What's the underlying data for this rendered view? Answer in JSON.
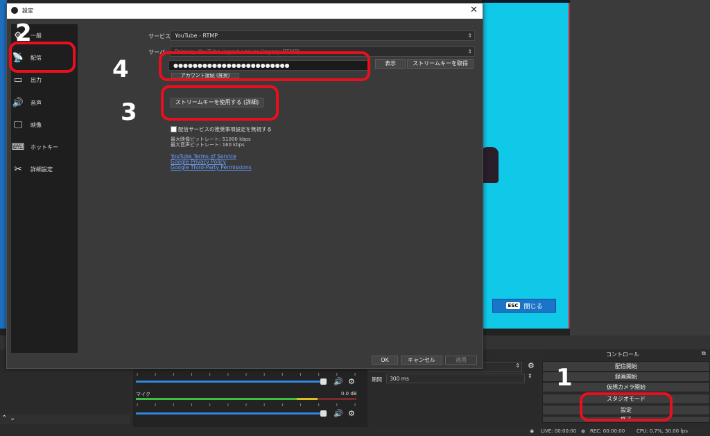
{
  "dialog": {
    "title": "設定",
    "sidebar": [
      {
        "label": "一般",
        "icon": "gear-icon"
      },
      {
        "label": "配信",
        "icon": "broadcast-tower-icon"
      },
      {
        "label": "出力",
        "icon": "output-icon"
      },
      {
        "label": "音声",
        "icon": "speaker-icon"
      },
      {
        "label": "映像",
        "icon": "monitor-icon"
      },
      {
        "label": "ホットキー",
        "icon": "keyboard-icon"
      },
      {
        "label": "詳細設定",
        "icon": "tools-icon"
      }
    ],
    "service_label": "サービス",
    "service_value": "YouTube - RTMP",
    "server_label": "サーバ",
    "server_value": "Primary YouTube ingest server (legacy RTMP)",
    "stream_key_value": "●●●●●●●●●●●●●●●●●●●●●●●●",
    "show_button": "表示",
    "get_key_button": "ストリームキーを取得",
    "connect_account_button": "アカウント接続 (推奨)",
    "use_stream_key_button": "ストリームキーを使用する (詳細)",
    "ignore_checkbox_label": "配信サービスの推奨事項設定を無視する",
    "max_video_bitrate": "最大映像ビットレート: 51000 kbps",
    "max_audio_bitrate": "最大音声ビットレート: 160 kbps",
    "links": [
      "YouTube Terms of Service",
      "Google Privacy Policy",
      "Google Third-Party Permissions"
    ],
    "ok_button": "OK",
    "cancel_button": "キャンセル",
    "apply_button": "適用"
  },
  "preview": {
    "close_button": "閉じる",
    "esc_label": "ESC"
  },
  "controls": {
    "title": "コントロール",
    "buttons": [
      "配信開始",
      "録画開始",
      "仮想カメラ開始",
      "スタジオモード",
      "設定",
      "終了"
    ]
  },
  "transitions": {
    "duration_label": "期間",
    "duration_value": "300 ms"
  },
  "mixer": {
    "channel_name": "マイク",
    "db_value": "0.0 dB",
    "scale": [
      "-60",
      "-55",
      "-50",
      "-45",
      "-40",
      "-35",
      "-30",
      "-25",
      "-20",
      "-15",
      "-10",
      "-5",
      "0"
    ]
  },
  "status_bar": {
    "live": "LIVE: 00:00:00",
    "rec": "REC: 00:00:00",
    "cpu": "CPU: 0.7%, 30.00 fps"
  },
  "annotations": {
    "n1": "1",
    "n2": "2",
    "n3": "3",
    "n4": "4"
  },
  "colors": {
    "annotation_red": "#e8101e",
    "preview_cyan": "#10c8e8",
    "link_blue": "#6aa0ff"
  }
}
